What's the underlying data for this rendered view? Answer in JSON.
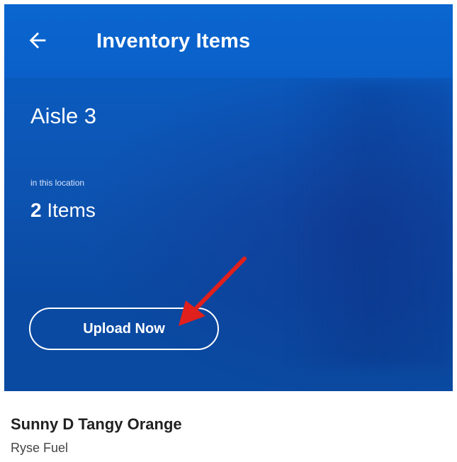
{
  "appbar": {
    "title": "Inventory Items",
    "back_icon": "arrow-left-icon"
  },
  "location": {
    "name": "Aisle 3",
    "caption": "in this location",
    "item_count": "2",
    "item_count_suffix": " Items"
  },
  "actions": {
    "upload_label": "Upload Now"
  },
  "annotation": {
    "arrow_color": "#e0201c"
  },
  "items": [
    {
      "name": "Sunny D Tangy Orange",
      "brand": "Ryse Fuel"
    }
  ],
  "colors": {
    "primary_blue": "#0a5bbf",
    "appbar_blue": "#0b66d0",
    "text_dark": "#222222"
  }
}
